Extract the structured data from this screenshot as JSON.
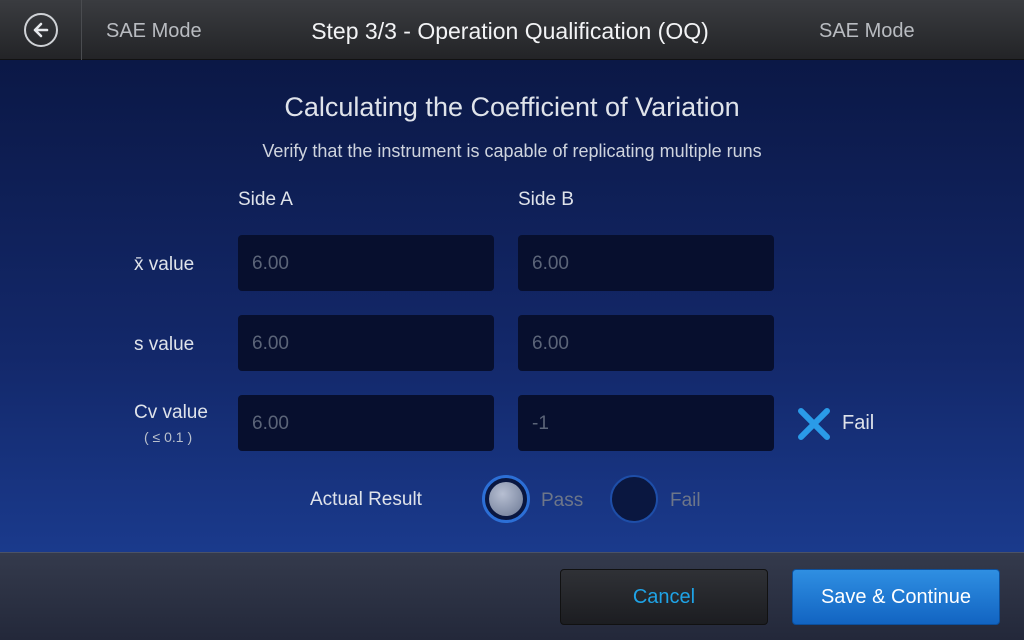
{
  "header": {
    "left_mode": "SAE Mode",
    "title": "Step 3/3 - Operation Qualification (OQ)",
    "right_mode": "SAE Mode"
  },
  "main": {
    "title": "Calculating the Coefficient of Variation",
    "subtitle": "Verify that the instrument is capable of replicating multiple runs",
    "columns": [
      "Side A",
      "Side B"
    ],
    "rows": [
      {
        "label": "x̄ value",
        "sub": "",
        "side_a": "6.00",
        "side_b": "6.00"
      },
      {
        "label": "s value",
        "sub": "",
        "side_a": "6.00",
        "side_b": "6.00"
      },
      {
        "label": "Cv value",
        "sub": "( ≤ 0.1 )",
        "side_a": "6.00",
        "side_b": "-1"
      }
    ],
    "cv_result": {
      "icon": "x-icon",
      "label": "Fail",
      "color": "#2a9be8"
    },
    "actual_result": {
      "label": "Actual Result",
      "options": [
        {
          "label": "Pass",
          "selected": true
        },
        {
          "label": "Fail",
          "selected": false
        }
      ]
    }
  },
  "footer": {
    "cancel_label": "Cancel",
    "save_label": "Save & Continue"
  },
  "colors": {
    "accent": "#1fa3e6",
    "primary_button": "#1b78d4"
  }
}
